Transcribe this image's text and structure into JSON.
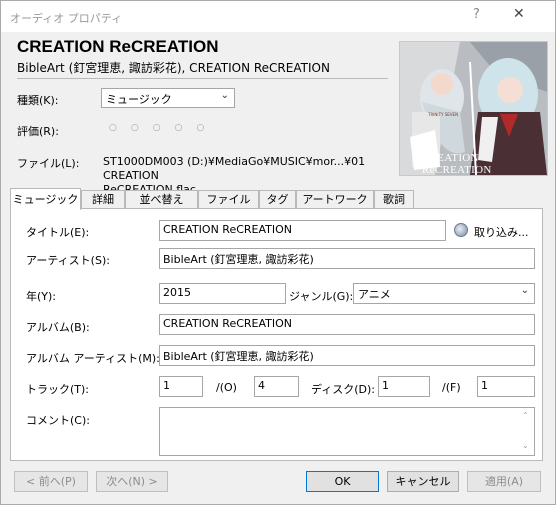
{
  "window": {
    "title": "オーディオ プロパティ",
    "help_glyph": "?",
    "close_glyph": "✕"
  },
  "header": {
    "title": "CREATION ReCREATION",
    "subtitle": "BibleArt (釘宮理恵, 諏訪彩花), CREATION ReCREATION"
  },
  "kind": {
    "label": "種類(K):",
    "value": "ミュージック",
    "arrow": "⌄"
  },
  "rating": {
    "label": "評価(R):",
    "value": 0,
    "max": 5,
    "glyph": "○"
  },
  "file": {
    "label": "ファイル(L):",
    "line1": "ST1000DM003 (D:)¥MediaGo¥MUSIC¥mor...¥01 CREATION",
    "line2": "ReCREATION.flac"
  },
  "artwork": {
    "title_small": "TRINITY SEVEN",
    "title": "CREATION ReCREATION",
    "colors": {
      "bg": "#b9bcc0",
      "dark": "#4a2f35",
      "hair": "#cfd8dc"
    }
  },
  "tabs": [
    {
      "label": "ミュージック"
    },
    {
      "label": "詳細"
    },
    {
      "label": "並べ替え"
    },
    {
      "label": "ファイル"
    },
    {
      "label": "タグ"
    },
    {
      "label": "アートワーク"
    },
    {
      "label": "歌詞"
    }
  ],
  "fields": {
    "title": {
      "label": "タイトル(E):",
      "value": "CREATION ReCREATION"
    },
    "import": {
      "label": "取り込み..."
    },
    "artist": {
      "label": "アーティスト(S):",
      "value": "BibleArt (釘宮理恵, 諏訪彩花)"
    },
    "year": {
      "label": "年(Y):",
      "value": "2015"
    },
    "genre": {
      "label": "ジャンル(G):",
      "value": "アニメ",
      "arrow": "⌄"
    },
    "album": {
      "label": "アルバム(B):",
      "value": "CREATION ReCREATION"
    },
    "album_artist": {
      "label": "アルバム アーティスト(M):",
      "value": "BibleArt (釘宮理恵, 諏訪彩花)"
    },
    "track": {
      "label": "トラック(T):",
      "value": "1",
      "of_label": "/(O)",
      "of_value": "4"
    },
    "disc": {
      "label": "ディスク(D):",
      "value": "1",
      "of_label": "/(F)",
      "of_value": "1"
    },
    "comment": {
      "label": "コメント(C):",
      "value": "",
      "scroll_up": "⌃",
      "scroll_down": "⌄"
    }
  },
  "buttons": {
    "prev": "< 前へ(P)",
    "next": "次へ(N) >",
    "ok": "OK",
    "cancel": "キャンセル",
    "apply": "適用(A)"
  }
}
